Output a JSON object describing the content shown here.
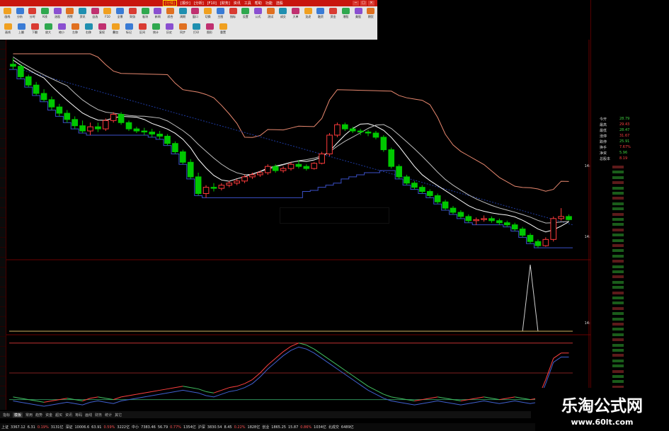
{
  "menu": {
    "items": [
      "[行情]",
      "[报价]",
      "[分析]",
      "[F10]",
      "[财务]",
      "资讯",
      "工具",
      "帮助",
      "功能",
      "选股"
    ],
    "active": "[行情]"
  },
  "toolbar_row1": [
    "画线",
    "分析",
    "分时",
    "K线",
    "选股",
    "预警",
    "资讯",
    "自选",
    "F10",
    "全景",
    "财务",
    "板块",
    "新闻",
    "综合",
    "周期",
    "窗口",
    "切换",
    "主图",
    "指标",
    "设置",
    "公式",
    "测试",
    "成交",
    "大单",
    "龙虎",
    "融资",
    "资金",
    "港股",
    "美股",
    "期货"
  ],
  "toolbar_row2": [
    "画线",
    "上翻",
    "下翻",
    "放大",
    "缩小",
    "左移",
    "右移",
    "复权",
    "叠加",
    "标记",
    "区间",
    "统计",
    "历史",
    "同步",
    "打印",
    "图形",
    "重置"
  ],
  "chart_data": [
    {
      "type": "candlestick",
      "pane": "main",
      "title": "",
      "ylim": [
        1.0,
        20.0
      ],
      "ohlc": [
        [
          19.0,
          19.6,
          18.5,
          18.8
        ],
        [
          18.8,
          19.0,
          17.6,
          17.8
        ],
        [
          17.8,
          18.0,
          16.8,
          17.0
        ],
        [
          17.0,
          17.3,
          16.0,
          16.2
        ],
        [
          16.2,
          16.6,
          15.4,
          15.6
        ],
        [
          15.6,
          15.9,
          14.6,
          14.9
        ],
        [
          14.9,
          15.2,
          14.0,
          14.3
        ],
        [
          14.3,
          14.6,
          13.4,
          13.7
        ],
        [
          13.7,
          14.0,
          12.8,
          13.1
        ],
        [
          13.1,
          13.6,
          12.4,
          12.6
        ],
        [
          12.6,
          13.4,
          12.2,
          13.0
        ],
        [
          13.0,
          13.4,
          12.5,
          12.8
        ],
        [
          12.8,
          13.8,
          12.6,
          13.6
        ],
        [
          13.6,
          14.4,
          13.4,
          14.2
        ],
        [
          14.2,
          14.4,
          13.2,
          13.4
        ],
        [
          13.4,
          13.6,
          12.6,
          12.8
        ],
        [
          12.8,
          13.0,
          12.4,
          12.6
        ],
        [
          12.6,
          12.9,
          12.2,
          12.5
        ],
        [
          12.5,
          12.8,
          12.0,
          12.3
        ],
        [
          12.3,
          12.6,
          11.8,
          12.1
        ],
        [
          12.1,
          12.3,
          11.2,
          11.4
        ],
        [
          11.4,
          11.6,
          10.4,
          10.6
        ],
        [
          10.6,
          10.8,
          9.4,
          9.6
        ],
        [
          9.6,
          9.9,
          8.0,
          8.2
        ],
        [
          8.2,
          8.6,
          6.4,
          6.6
        ],
        [
          6.6,
          7.4,
          6.2,
          7.2
        ],
        [
          7.2,
          7.6,
          6.8,
          7.1
        ],
        [
          7.1,
          7.6,
          6.9,
          7.4
        ],
        [
          7.4,
          7.8,
          7.2,
          7.6
        ],
        [
          7.6,
          8.0,
          7.4,
          7.8
        ],
        [
          7.8,
          8.4,
          7.6,
          8.2
        ],
        [
          8.2,
          8.6,
          8.0,
          8.4
        ],
        [
          8.4,
          8.8,
          8.2,
          8.6
        ],
        [
          8.6,
          9.4,
          8.4,
          9.2
        ],
        [
          9.2,
          9.4,
          8.6,
          8.8
        ],
        [
          8.8,
          9.2,
          8.6,
          9.0
        ],
        [
          9.0,
          9.6,
          8.8,
          9.4
        ],
        [
          9.4,
          9.8,
          9.0,
          9.2
        ],
        [
          9.2,
          9.4,
          8.8,
          9.0
        ],
        [
          9.0,
          9.6,
          8.9,
          9.5
        ],
        [
          9.5,
          10.6,
          9.4,
          10.4
        ],
        [
          10.4,
          12.4,
          10.2,
          12.2
        ],
        [
          12.2,
          13.4,
          12.0,
          13.2
        ],
        [
          13.2,
          13.4,
          12.6,
          12.8
        ],
        [
          12.8,
          13.0,
          12.4,
          12.6
        ],
        [
          12.6,
          12.8,
          12.2,
          12.5
        ],
        [
          12.5,
          12.7,
          12.1,
          12.4
        ],
        [
          12.4,
          12.6,
          11.8,
          12.0
        ],
        [
          12.0,
          12.2,
          10.6,
          10.8
        ],
        [
          10.8,
          11.0,
          9.0,
          9.2
        ],
        [
          9.2,
          9.4,
          8.0,
          8.2
        ],
        [
          8.2,
          8.4,
          7.4,
          7.6
        ],
        [
          7.6,
          7.8,
          7.0,
          7.2
        ],
        [
          7.2,
          7.4,
          6.6,
          6.8
        ],
        [
          6.8,
          7.0,
          6.2,
          6.4
        ],
        [
          6.4,
          6.6,
          5.6,
          5.8
        ],
        [
          5.8,
          6.0,
          5.0,
          5.2
        ],
        [
          5.2,
          5.4,
          4.6,
          4.8
        ],
        [
          4.8,
          5.0,
          4.2,
          4.4
        ],
        [
          4.4,
          4.6,
          3.8,
          4.0
        ],
        [
          4.0,
          4.3,
          3.6,
          4.1
        ],
        [
          4.1,
          4.5,
          3.9,
          4.2
        ],
        [
          4.2,
          4.4,
          3.8,
          4.0
        ],
        [
          4.0,
          4.2,
          3.6,
          3.8
        ],
        [
          3.8,
          4.0,
          3.4,
          3.6
        ],
        [
          3.6,
          3.8,
          3.0,
          3.2
        ],
        [
          3.2,
          3.4,
          2.4,
          2.6
        ],
        [
          2.6,
          2.8,
          1.8,
          2.0
        ],
        [
          2.0,
          2.2,
          1.4,
          1.6
        ],
        [
          1.6,
          2.4,
          1.5,
          2.2
        ],
        [
          2.2,
          4.4,
          2.0,
          4.2
        ],
        [
          4.2,
          5.2,
          4.0,
          4.4
        ],
        [
          4.4,
          4.6,
          4.0,
          4.1
        ]
      ],
      "ma_lines": 2,
      "grid": false
    },
    {
      "type": "line",
      "pane": "indicator1",
      "title": "",
      "ylim": [
        0,
        1
      ],
      "values": [
        0,
        0,
        0,
        0,
        0,
        0,
        0,
        0,
        0,
        0,
        0,
        0,
        0,
        0,
        0,
        0,
        0,
        0,
        0,
        0,
        0,
        0,
        0,
        0,
        0,
        0,
        0,
        0,
        0,
        0,
        0,
        0,
        0,
        0,
        0,
        0,
        0,
        0,
        0,
        0,
        0,
        0,
        0,
        0,
        0,
        0,
        0,
        0,
        0,
        0,
        0,
        0,
        0,
        0,
        0,
        0,
        0,
        0,
        0,
        0,
        0,
        0,
        0,
        0,
        0,
        0,
        0,
        1,
        0,
        0,
        0,
        0,
        0
      ]
    },
    {
      "type": "line",
      "pane": "indicator2",
      "title": "",
      "ylim": [
        0,
        100
      ],
      "values": [
        14,
        12,
        10,
        8,
        6,
        8,
        10,
        12,
        10,
        8,
        12,
        14,
        12,
        10,
        14,
        16,
        18,
        20,
        22,
        24,
        26,
        28,
        30,
        28,
        26,
        22,
        20,
        24,
        28,
        30,
        34,
        40,
        50,
        62,
        72,
        82,
        90,
        95,
        92,
        86,
        78,
        70,
        62,
        54,
        46,
        38,
        30,
        24,
        18,
        14,
        12,
        10,
        8,
        10,
        12,
        14,
        12,
        10,
        8,
        10,
        12,
        14,
        12,
        10,
        12,
        14,
        12,
        10,
        12,
        40,
        72,
        80,
        80
      ]
    }
  ],
  "status_bar": [
    "上证",
    "3367.12",
    "6.31",
    "0.19%",
    "3131亿",
    "深证",
    "10006.6",
    "63.91",
    "0.59%",
    "3222亿",
    "中小",
    "7383.46",
    "56.79",
    "0.77%",
    "1354亿",
    "沪深",
    "3830.54",
    "8.45",
    "0.22%",
    "1828亿",
    "创业",
    "1865.25",
    "15.87",
    "0.86%",
    "1034亿",
    "北成交",
    "6489亿"
  ],
  "tabs": [
    "指标",
    "模板",
    "常用",
    "趋势",
    "资金",
    "超买",
    "资讯",
    "筹码",
    "画线",
    "财务",
    "统计",
    "其它"
  ],
  "active_tab": "模板",
  "time_labels": [
    "14:54",
    "14:55",
    "14:56"
  ],
  "quote_labels": [
    "今开",
    "最高",
    "最低",
    "涨停",
    "跌停",
    "换手",
    "净资",
    "总股本"
  ],
  "quote_values": [
    "28.79",
    "29.43",
    "28.47",
    "31.67",
    "25.91",
    "7.67%",
    "5.96",
    "8.19"
  ],
  "watermark": {
    "line1": "乐淘公式网",
    "line2": "www.60lt.com"
  },
  "colors": {
    "menu_bg": "#c8150e",
    "up": "#ff3b3b",
    "down": "#00c800",
    "ma1": "#ffffff",
    "ma2": "#bfbfbf",
    "resistance": "#e8886f",
    "support": "#3b50c8",
    "trend": "#1e3aa0"
  }
}
